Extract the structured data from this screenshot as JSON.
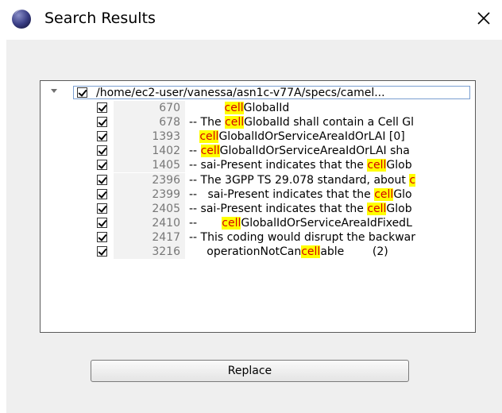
{
  "window": {
    "title": "Search Results",
    "icon": "eclipse-sphere-icon",
    "close_icon": "close-icon"
  },
  "tree": {
    "root_path": "/home/ec2-user/vanessa/asn1c-v77A/specs/camel...",
    "root_checked": true,
    "results": [
      {
        "line": "670",
        "pre": "          ",
        "match": "cell",
        "post": "GlobalId",
        "checked": true
      },
      {
        "line": "678",
        "pre": "-- The ",
        "match": "cell",
        "post": "GlobalId shall contain a Cell Gl",
        "checked": true
      },
      {
        "line": "1393",
        "pre": "   ",
        "match": "cell",
        "post": "GlobalIdOrServiceAreaIdOrLAI [0]",
        "checked": true
      },
      {
        "line": "1402",
        "pre": "-- ",
        "match": "cell",
        "post": "GlobalIdOrServiceAreaIdOrLAI sha",
        "checked": true
      },
      {
        "line": "1405",
        "pre": "-- sai-Present indicates that the ",
        "match": "cell",
        "post": "Glob",
        "checked": true
      },
      {
        "line": "2396",
        "pre": "-- The 3GPP TS 29.078 standard, about ",
        "match": "c",
        "post": "",
        "checked": true
      },
      {
        "line": "2399",
        "pre": "--   sai-Present indicates that the ",
        "match": "cell",
        "post": "Glo",
        "checked": true
      },
      {
        "line": "2405",
        "pre": "-- sai-Present indicates that the ",
        "match": "cell",
        "post": "Glob",
        "checked": true
      },
      {
        "line": "2410",
        "pre": "--       ",
        "match": "cell",
        "post": "GlobalIdOrServiceAreaIdFixedL",
        "checked": true
      },
      {
        "line": "2417",
        "pre": "-- This coding would disrupt the backwar",
        "match": "",
        "post": "",
        "checked": true
      },
      {
        "line": "3216",
        "pre": "     operationNotCan",
        "match": "cell",
        "post": "able        (2)",
        "checked": true
      }
    ]
  },
  "actions": {
    "replace_label": "Replace"
  }
}
